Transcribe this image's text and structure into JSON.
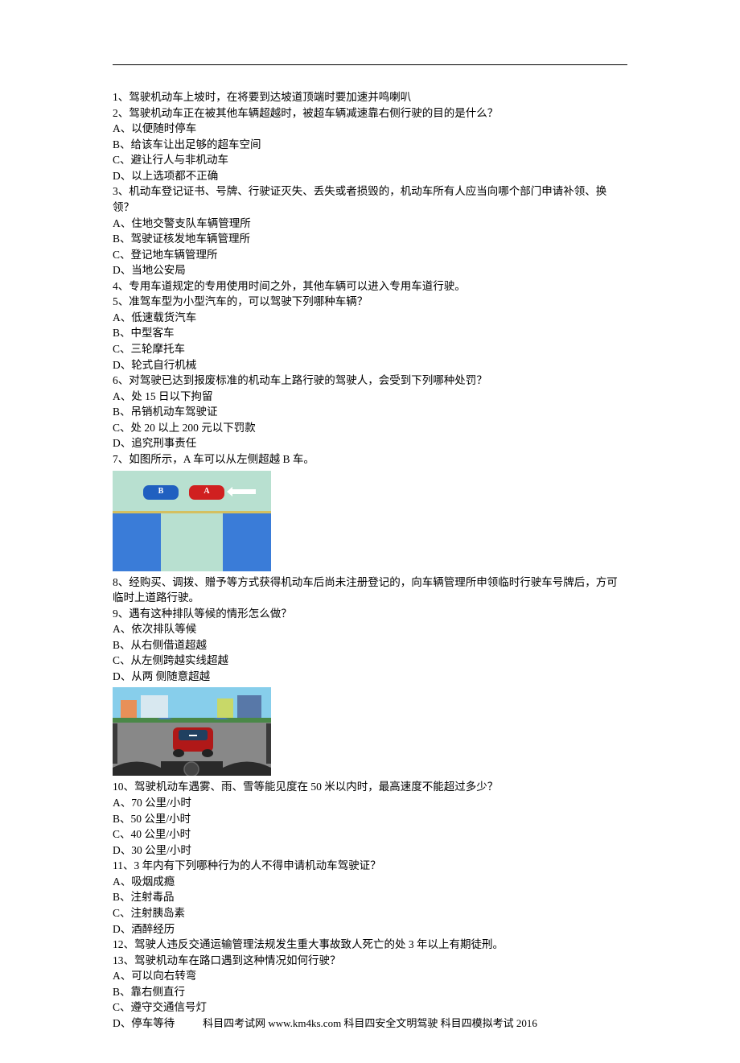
{
  "questions": [
    {
      "num": "1",
      "text": "驾驶机动车上坡时，在将要到达坡道顶端时要加速并鸣喇叭"
    },
    {
      "num": "2",
      "text": "驾驶机动车正在被其他车辆超越时，被超车辆减速靠右侧行驶的目的是什么？",
      "opts": [
        "A、以便随时停车",
        "B、给该车让出足够的超车空间",
        "C、避让行人与非机动车",
        "D、以上选项都不正确"
      ]
    },
    {
      "num": "3",
      "text": "机动车登记证书、号牌、行驶证灭失、丢失或者损毁的，机动车所有人应当向哪个部门申请补领、换领？",
      "opts": [
        "A、住地交警支队车辆管理所",
        "B、驾驶证核发地车辆管理所",
        "C、登记地车辆管理所",
        "D、当地公安局"
      ]
    },
    {
      "num": "4",
      "text": "专用车道规定的专用使用时间之外，其他车辆可以进入专用车道行驶。"
    },
    {
      "num": "5",
      "text": "准驾车型为小型汽车的，可以驾驶下列哪种车辆？",
      "opts": [
        "A、低速载货汽车",
        "B、中型客车",
        "C、三轮摩托车",
        "D、轮式自行机械"
      ]
    },
    {
      "num": "6",
      "text": "对驾驶已达到报废标准的机动车上路行驶的驾驶人，会受到下列哪种处罚？",
      "opts": [
        "A、处 15 日以下拘留",
        "B、吊销机动车驾驶证",
        "C、处 20 以上 200 元以下罚款",
        "D、追究刑事责任"
      ]
    },
    {
      "num": "7",
      "text": "如图所示，A 车可以从左侧超越 B 车。"
    },
    {
      "num": "8",
      "text": "经购买、调拨、赠予等方式获得机动车后尚未注册登记的，向车辆管理所申领临时行驶车号牌后，方可临时上道路行驶。"
    },
    {
      "num": "9",
      "text": "遇有这种排队等候的情形怎么做？",
      "opts": [
        "A、依次排队等候",
        "B、从右侧借道超越",
        "C、从左侧跨越实线超越",
        "D、从两 侧随意超越"
      ]
    },
    {
      "num": "10",
      "text": "驾驶机动车遇雾、雨、雪等能见度在 50 米以内时，最高速度不能超过多少？",
      "opts": [
        "A、70 公里/小时",
        "B、50 公里/小时",
        "C、40 公里/小时",
        "D、30 公里/小时"
      ]
    },
    {
      "num": "11",
      "text": "3 年内有下列哪种行为的人不得申请机动车驾驶证？",
      "opts": [
        "A、吸烟成瘾",
        "B、注射毒品",
        "C、注射胰岛素",
        "D、酒醉经历"
      ]
    },
    {
      "num": "12",
      "text": "驾驶人违反交通运输管理法规发生重大事故致人死亡的处 3 年以上有期徒刑。"
    },
    {
      "num": "13",
      "text": "驾驶机动车在路口遇到这种情况如何行驶？",
      "opts": [
        "A、可以向右转弯",
        "B、靠右侧直行",
        "C、遵守交通信号灯",
        "D、停车等待"
      ]
    }
  ],
  "car_b_label": "B",
  "car_a_label": "A",
  "footer": "科目四考试网  www.km4ks.com 科目四安全文明驾驶  科目四模拟考试 2016"
}
